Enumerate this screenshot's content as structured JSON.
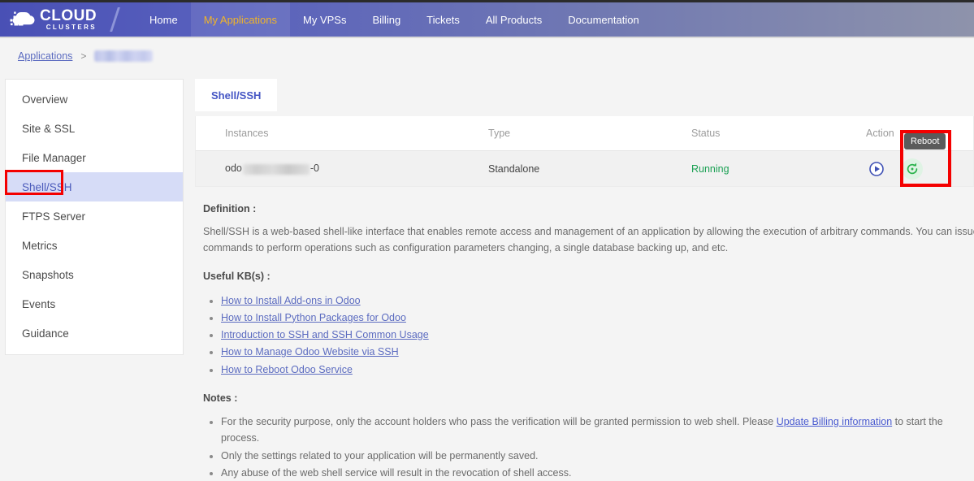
{
  "navbar": {
    "logo": {
      "primary": "CLOUD",
      "secondary": "CLUSTERS",
      "icon": "cloud-pixel-icon"
    },
    "links": [
      {
        "label": "Home",
        "active": false
      },
      {
        "label": "My Applications",
        "active": true
      },
      {
        "label": "My VPSs",
        "active": false
      },
      {
        "label": "Billing",
        "active": false
      },
      {
        "label": "Tickets",
        "active": false
      },
      {
        "label": "All Products",
        "active": false
      },
      {
        "label": "Documentation",
        "active": false
      }
    ],
    "colors": {
      "gradient_start": "#4950b5",
      "gradient_end": "#8e93ab",
      "active_text": "#f0b429"
    }
  },
  "breadcrumb": {
    "root": "Applications",
    "separator": ">",
    "current_redacted": true
  },
  "sidebar": {
    "items": [
      {
        "label": "Overview",
        "selected": false
      },
      {
        "label": "Site & SSL",
        "selected": false
      },
      {
        "label": "File Manager",
        "selected": false
      },
      {
        "label": "Shell/SSH",
        "selected": true
      },
      {
        "label": "FTPS Server",
        "selected": false
      },
      {
        "label": "Metrics",
        "selected": false
      },
      {
        "label": "Snapshots",
        "selected": false
      },
      {
        "label": "Events",
        "selected": false
      },
      {
        "label": "Guidance",
        "selected": false
      }
    ],
    "selected_highlight_color": "#f40000"
  },
  "main": {
    "tab": {
      "label": "Shell/SSH"
    },
    "table": {
      "headers": {
        "instances": "Instances",
        "type": "Type",
        "status": "Status",
        "action": "Action"
      },
      "row": {
        "instance_prefix": "odo",
        "instance_suffix": "-0",
        "type": "Standalone",
        "status": "Running",
        "status_color": "#1aa053",
        "actions": [
          {
            "name": "launch-icon",
            "title": "Launch"
          },
          {
            "name": "reboot-icon",
            "title": "Reboot"
          }
        ]
      }
    },
    "tooltip": {
      "label": "Reboot"
    }
  },
  "article": {
    "definition_title": "Definition :",
    "definition_body": "Shell/SSH is a web-based shell-like interface that enables remote access and management of an application by allowing the execution of arbitrary commands. You can issue commands to perform operations such as configuration parameters changing, a single database backing up, and etc.",
    "kb_title": "Useful KB(s) :",
    "kb_links": [
      "How to Install Add-ons in Odoo",
      "How to Install Python Packages for Odoo",
      "Introduction to SSH and SSH Common Usage",
      "How to Manage Odoo Website via SSH",
      "How to Reboot Odoo Service"
    ],
    "notes_title": "Notes :",
    "notes": [
      {
        "before": "For the security purpose, only the account holders who pass the verification will be granted permission to web shell. Please ",
        "link": "Update Billing information",
        "after": " to start the process."
      },
      {
        "before": "Only the settings related to your application will be permanently saved.",
        "link": "",
        "after": ""
      },
      {
        "before": "Any abuse of the web shell service will result in the revocation of shell access.",
        "link": "",
        "after": ""
      }
    ]
  }
}
